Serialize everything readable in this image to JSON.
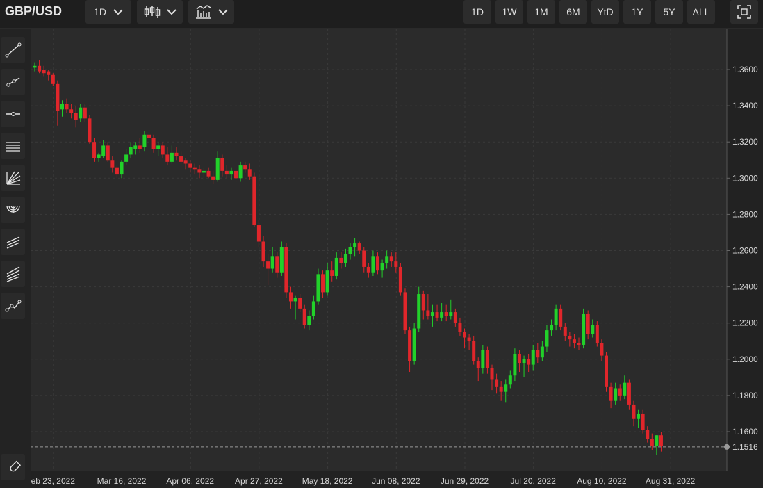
{
  "header": {
    "symbol": "GBP/USD",
    "interval": "1D",
    "ranges": [
      "1D",
      "1W",
      "1M",
      "6M",
      "YtD",
      "1Y",
      "5Y",
      "ALL"
    ]
  },
  "toolbar": {
    "tools": [
      "trend-line-icon",
      "ray-icon",
      "horizontal-line-icon",
      "parallel-channel-icon",
      "fibonacci-fan-icon",
      "fibonacci-arc-icon",
      "regression-channel-icon",
      "pitchfork-icon",
      "path-tool-icon"
    ],
    "magnet_icon": "magnet-icon"
  },
  "colors": {
    "up": "#22d12a",
    "down": "#e0262b",
    "grid": "#3a3a3a",
    "background": "#2b2b2b"
  },
  "chart_data": {
    "type": "candlestick",
    "series_unit": "GBP/USD daily",
    "ylim": [
      1.145,
      1.375
    ],
    "yticks": [
      "1.3600",
      "1.3400",
      "1.3200",
      "1.3000",
      "1.2800",
      "1.2600",
      "1.2400",
      "1.2200",
      "1.2000",
      "1.1800",
      "1.1600"
    ],
    "ytick_values": [
      1.36,
      1.34,
      1.32,
      1.3,
      1.28,
      1.26,
      1.24,
      1.22,
      1.2,
      1.18,
      1.16
    ],
    "xticks": [
      "eb 23, 2022",
      "Mar 16, 2022",
      "Apr 06, 2022",
      "Apr 27, 2022",
      "May 18, 2022",
      "Jun 08, 2022",
      "Jun 29, 2022",
      "Jul 20, 2022",
      "Aug 10, 2022",
      "Aug 31, 2022"
    ],
    "xtick_index": [
      4,
      19,
      34,
      49,
      64,
      79,
      94,
      109,
      124,
      139
    ],
    "last_price": "1.1516",
    "last_value": 1.1516,
    "ohlc": [
      [
        1.361,
        1.364,
        1.359,
        1.362
      ],
      [
        1.362,
        1.365,
        1.358,
        1.359
      ],
      [
        1.36,
        1.362,
        1.356,
        1.358
      ],
      [
        1.359,
        1.36,
        1.354,
        1.357
      ],
      [
        1.357,
        1.358,
        1.351,
        1.352
      ],
      [
        1.352,
        1.354,
        1.329,
        1.337
      ],
      [
        1.338,
        1.343,
        1.334,
        1.341
      ],
      [
        1.341,
        1.344,
        1.336,
        1.338
      ],
      [
        1.338,
        1.341,
        1.333,
        1.336
      ],
      [
        1.336,
        1.34,
        1.328,
        1.332
      ],
      [
        1.333,
        1.341,
        1.331,
        1.339
      ],
      [
        1.339,
        1.341,
        1.331,
        1.333
      ],
      [
        1.333,
        1.335,
        1.319,
        1.32
      ],
      [
        1.32,
        1.322,
        1.309,
        1.311
      ],
      [
        1.311,
        1.314,
        1.309,
        1.313
      ],
      [
        1.312,
        1.321,
        1.311,
        1.318
      ],
      [
        1.318,
        1.32,
        1.309,
        1.31
      ],
      [
        1.31,
        1.312,
        1.303,
        1.306
      ],
      [
        1.306,
        1.307,
        1.3,
        1.302
      ],
      [
        1.302,
        1.31,
        1.3,
        1.309
      ],
      [
        1.309,
        1.316,
        1.307,
        1.313
      ],
      [
        1.313,
        1.32,
        1.311,
        1.317
      ],
      [
        1.316,
        1.32,
        1.313,
        1.318
      ],
      [
        1.318,
        1.322,
        1.314,
        1.316
      ],
      [
        1.317,
        1.326,
        1.315,
        1.324
      ],
      [
        1.324,
        1.33,
        1.32,
        1.322
      ],
      [
        1.322,
        1.324,
        1.314,
        1.316
      ],
      [
        1.316,
        1.32,
        1.312,
        1.318
      ],
      [
        1.318,
        1.32,
        1.311,
        1.313
      ],
      [
        1.313,
        1.317,
        1.307,
        1.309
      ],
      [
        1.309,
        1.318,
        1.308,
        1.314
      ],
      [
        1.314,
        1.317,
        1.31,
        1.312
      ],
      [
        1.312,
        1.315,
        1.308,
        1.309
      ],
      [
        1.31,
        1.311,
        1.305,
        1.308
      ],
      [
        1.308,
        1.31,
        1.303,
        1.306
      ],
      [
        1.306,
        1.308,
        1.302,
        1.305
      ],
      [
        1.305,
        1.307,
        1.3,
        1.303
      ],
      [
        1.303,
        1.306,
        1.299,
        1.304
      ],
      [
        1.304,
        1.306,
        1.3,
        1.301
      ],
      [
        1.301,
        1.304,
        1.297,
        1.299
      ],
      [
        1.299,
        1.315,
        1.298,
        1.311
      ],
      [
        1.311,
        1.313,
        1.301,
        1.304
      ],
      [
        1.304,
        1.307,
        1.3,
        1.302
      ],
      [
        1.302,
        1.306,
        1.299,
        1.304
      ],
      [
        1.304,
        1.306,
        1.298,
        1.3
      ],
      [
        1.3,
        1.309,
        1.298,
        1.307
      ],
      [
        1.307,
        1.309,
        1.303,
        1.305
      ],
      [
        1.305,
        1.308,
        1.299,
        1.301
      ],
      [
        1.301,
        1.303,
        1.273,
        1.274
      ],
      [
        1.274,
        1.277,
        1.262,
        1.265
      ],
      [
        1.265,
        1.268,
        1.251,
        1.254
      ],
      [
        1.254,
        1.258,
        1.241,
        1.25
      ],
      [
        1.25,
        1.262,
        1.248,
        1.257
      ],
      [
        1.257,
        1.259,
        1.245,
        1.248
      ],
      [
        1.248,
        1.265,
        1.246,
        1.262
      ],
      [
        1.262,
        1.264,
        1.234,
        1.237
      ],
      [
        1.237,
        1.24,
        1.228,
        1.232
      ],
      [
        1.232,
        1.235,
        1.222,
        1.234
      ],
      [
        1.234,
        1.236,
        1.226,
        1.228
      ],
      [
        1.228,
        1.23,
        1.217,
        1.219
      ],
      [
        1.219,
        1.227,
        1.216,
        1.224
      ],
      [
        1.224,
        1.235,
        1.222,
        1.232
      ],
      [
        1.232,
        1.25,
        1.23,
        1.247
      ],
      [
        1.247,
        1.249,
        1.234,
        1.237
      ],
      [
        1.237,
        1.253,
        1.235,
        1.249
      ],
      [
        1.249,
        1.254,
        1.243,
        1.246
      ],
      [
        1.246,
        1.259,
        1.244,
        1.256
      ],
      [
        1.256,
        1.259,
        1.25,
        1.253
      ],
      [
        1.253,
        1.261,
        1.251,
        1.258
      ],
      [
        1.258,
        1.264,
        1.255,
        1.262
      ],
      [
        1.262,
        1.267,
        1.257,
        1.264
      ],
      [
        1.264,
        1.265,
        1.258,
        1.26
      ],
      [
        1.26,
        1.262,
        1.248,
        1.251
      ],
      [
        1.251,
        1.253,
        1.245,
        1.248
      ],
      [
        1.248,
        1.26,
        1.246,
        1.257
      ],
      [
        1.257,
        1.259,
        1.247,
        1.249
      ],
      [
        1.249,
        1.255,
        1.245,
        1.253
      ],
      [
        1.253,
        1.26,
        1.25,
        1.257
      ],
      [
        1.257,
        1.259,
        1.251,
        1.254
      ],
      [
        1.254,
        1.259,
        1.248,
        1.251
      ],
      [
        1.251,
        1.253,
        1.235,
        1.237
      ],
      [
        1.237,
        1.239,
        1.214,
        1.216
      ],
      [
        1.216,
        1.218,
        1.193,
        1.199
      ],
      [
        1.199,
        1.22,
        1.197,
        1.217
      ],
      [
        1.217,
        1.24,
        1.215,
        1.236
      ],
      [
        1.236,
        1.238,
        1.222,
        1.227
      ],
      [
        1.227,
        1.236,
        1.222,
        1.224
      ],
      [
        1.224,
        1.23,
        1.218,
        1.226
      ],
      [
        1.226,
        1.23,
        1.221,
        1.223
      ],
      [
        1.223,
        1.231,
        1.221,
        1.226
      ],
      [
        1.226,
        1.23,
        1.221,
        1.224
      ],
      [
        1.224,
        1.233,
        1.222,
        1.226
      ],
      [
        1.226,
        1.228,
        1.218,
        1.22
      ],
      [
        1.22,
        1.223,
        1.213,
        1.215
      ],
      [
        1.215,
        1.217,
        1.206,
        1.212
      ],
      [
        1.212,
        1.214,
        1.205,
        1.21
      ],
      [
        1.21,
        1.213,
        1.197,
        1.199
      ],
      [
        1.199,
        1.201,
        1.188,
        1.195
      ],
      [
        1.195,
        1.208,
        1.192,
        1.205
      ],
      [
        1.205,
        1.207,
        1.192,
        1.195
      ],
      [
        1.195,
        1.197,
        1.183,
        1.189
      ],
      [
        1.189,
        1.192,
        1.181,
        1.185
      ],
      [
        1.185,
        1.188,
        1.177,
        1.182
      ],
      [
        1.182,
        1.189,
        1.176,
        1.186
      ],
      [
        1.186,
        1.194,
        1.184,
        1.191
      ],
      [
        1.191,
        1.206,
        1.188,
        1.203
      ],
      [
        1.203,
        1.205,
        1.193,
        1.198
      ],
      [
        1.198,
        1.202,
        1.19,
        1.2
      ],
      [
        1.2,
        1.203,
        1.193,
        1.197
      ],
      [
        1.197,
        1.208,
        1.194,
        1.205
      ],
      [
        1.205,
        1.209,
        1.198,
        1.201
      ],
      [
        1.201,
        1.21,
        1.199,
        1.207
      ],
      [
        1.207,
        1.219,
        1.204,
        1.216
      ],
      [
        1.216,
        1.222,
        1.213,
        1.219
      ],
      [
        1.219,
        1.23,
        1.216,
        1.228
      ],
      [
        1.228,
        1.23,
        1.216,
        1.218
      ],
      [
        1.218,
        1.22,
        1.21,
        1.213
      ],
      [
        1.213,
        1.215,
        1.207,
        1.211
      ],
      [
        1.211,
        1.214,
        1.206,
        1.209
      ],
      [
        1.209,
        1.212,
        1.205,
        1.208
      ],
      [
        1.208,
        1.228,
        1.206,
        1.225
      ],
      [
        1.225,
        1.227,
        1.211,
        1.214
      ],
      [
        1.214,
        1.222,
        1.212,
        1.219
      ],
      [
        1.219,
        1.221,
        1.207,
        1.209
      ],
      [
        1.209,
        1.211,
        1.199,
        1.202
      ],
      [
        1.202,
        1.204,
        1.182,
        1.185
      ],
      [
        1.185,
        1.187,
        1.173,
        1.177
      ],
      [
        1.177,
        1.187,
        1.175,
        1.184
      ],
      [
        1.184,
        1.186,
        1.177,
        1.18
      ],
      [
        1.18,
        1.191,
        1.178,
        1.187
      ],
      [
        1.187,
        1.189,
        1.172,
        1.175
      ],
      [
        1.175,
        1.177,
        1.163,
        1.167
      ],
      [
        1.167,
        1.172,
        1.162,
        1.17
      ],
      [
        1.17,
        1.172,
        1.159,
        1.161
      ],
      [
        1.161,
        1.163,
        1.154,
        1.156
      ],
      [
        1.156,
        1.159,
        1.15,
        1.152
      ],
      [
        1.152,
        1.158,
        1.147,
        1.158
      ],
      [
        1.158,
        1.16,
        1.149,
        1.152
      ]
    ]
  }
}
